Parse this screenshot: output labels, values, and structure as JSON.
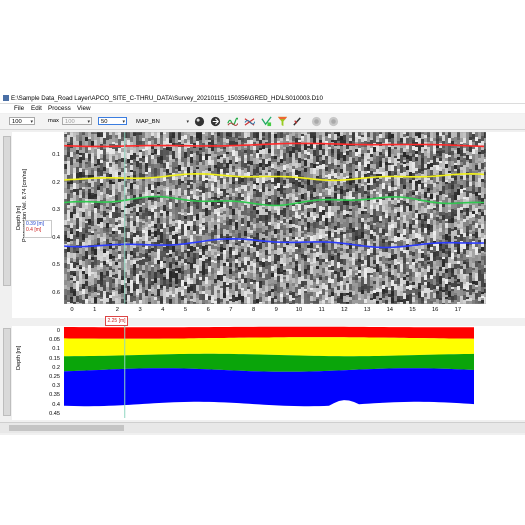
{
  "window": {
    "title": "E:\\Sample Data_Road Layer\\APCO_SITE_C-THRU_DATA\\Survey_20210115_150356\\GRED_HD\\LS010003.D10"
  },
  "menu": [
    "File",
    "Edit",
    "Process",
    "View"
  ],
  "toolbar": {
    "zoom_value": "100",
    "max_label": "max",
    "max_value": "100",
    "field3_value": "50",
    "colormap_value": "MAP_BN",
    "icons": [
      "filter-globe-icon",
      "filter-arrow-icon",
      "wave-icon",
      "cross-wave-icon",
      "pick-icon",
      "funnel-icon",
      "edit-icon",
      "layer-icon",
      "layer2-icon"
    ]
  },
  "radargram": {
    "axis_label": "Depth [m]",
    "velocity_label": "Propagation Vel. 8.74 [cm/ns]",
    "y_ticks": [
      "0.1",
      "0.2",
      "0.3",
      "0.4",
      "0.5",
      "0.6"
    ],
    "x_ticks": [
      "0",
      "1",
      "2",
      "3",
      "4",
      "5",
      "6",
      "7",
      "8",
      "9",
      "10",
      "11",
      "12",
      "13",
      "14",
      "15",
      "16",
      "17"
    ],
    "cursor_depth_1": "0.39 [m]",
    "cursor_depth_2": "0.4 [m]",
    "cursor_position": "2.25 [m]",
    "colors": {
      "red": "#ff2a2a",
      "yellow": "#f2f21a",
      "green": "#30c850",
      "blue": "#2c3cff",
      "cursor": "#8fd6c0"
    }
  },
  "layer_plot": {
    "axis_label": "Depth [m]",
    "y_ticks": [
      "0",
      "0.05",
      "0.1",
      "0.15",
      "0.2",
      "0.25",
      "0.3",
      "0.35",
      "0.4",
      "0.45"
    ],
    "colors": {
      "red": "#ff0000",
      "yellow": "#ffff00",
      "green": "#0aa50a",
      "blue": "#0000ff"
    }
  }
}
